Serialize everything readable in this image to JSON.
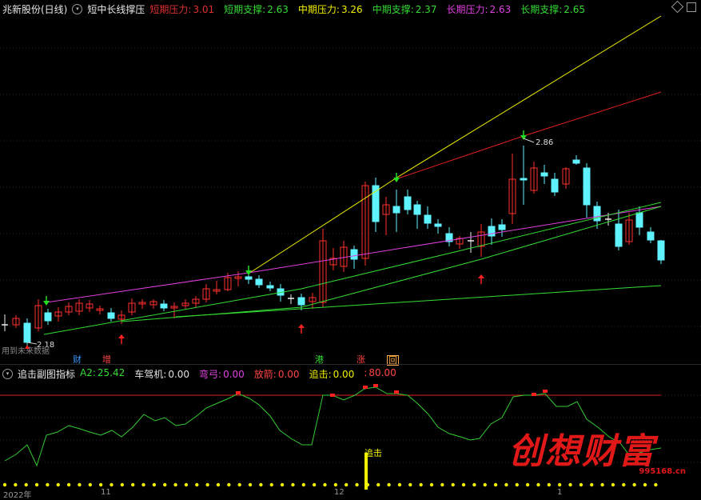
{
  "main_header": {
    "stock": "兆新股份(日线)",
    "indicator": "短中长线撑压",
    "items": [
      {
        "label": "短期压力:",
        "value": "3.01",
        "color": "#e03030"
      },
      {
        "label": "短期支撑:",
        "value": "2.63",
        "color": "#33dd33"
      },
      {
        "label": "中期压力:",
        "value": "3.26",
        "color": "#f0f000"
      },
      {
        "label": "中期支撑:",
        "value": "2.37",
        "color": "#33dd33"
      },
      {
        "label": "长期压力:",
        "value": "2.63",
        "color": "#e040e0"
      },
      {
        "label": "长期支撑:",
        "value": "2.65",
        "color": "#33dd33"
      }
    ]
  },
  "chart_annotations": {
    "high_label": "2.86",
    "low_label": "2.18",
    "future_note": "用到未来数据"
  },
  "event_tags": [
    {
      "text": "财",
      "color": "#3399ff"
    },
    {
      "text": "增",
      "color": "#ff4444"
    },
    {
      "text": "港",
      "color": "#33dd33"
    },
    {
      "text": "涨",
      "color": "#ff4444"
    },
    {
      "text": "回",
      "color": "#ffaa44"
    }
  ],
  "sub_header": {
    "indicator": "追击副图指标",
    "items": [
      {
        "label": "A2:",
        "value": "25.42",
        "color": "#33dd33"
      },
      {
        "label": "车驾机:",
        "value": "0.00",
        "color": "#e0e0e0"
      },
      {
        "label": "弯弓:",
        "value": "0.00",
        "color": "#e040e0"
      },
      {
        "label": "放箭:",
        "value": "0.00",
        "color": "#ff4444"
      },
      {
        "label": "追击:",
        "value": "0.00",
        "color": "#f0f000"
      },
      {
        "label": ":",
        "value": "80.00",
        "color": "#ff4444"
      }
    ]
  },
  "sub_annotations": {
    "chase_label": "追击"
  },
  "watermark": {
    "text": "创想财富",
    "url": "995168.cn"
  },
  "x_axis": {
    "labels": [
      "2022年",
      "11",
      "12",
      "1"
    ]
  },
  "colors": {
    "up": "#ff3030",
    "down": "#5ff2ff",
    "yellow_line": "#f0f000",
    "red_line": "#e02020",
    "magenta_line": "#e040e0",
    "green_line": "#33dd33"
  }
}
